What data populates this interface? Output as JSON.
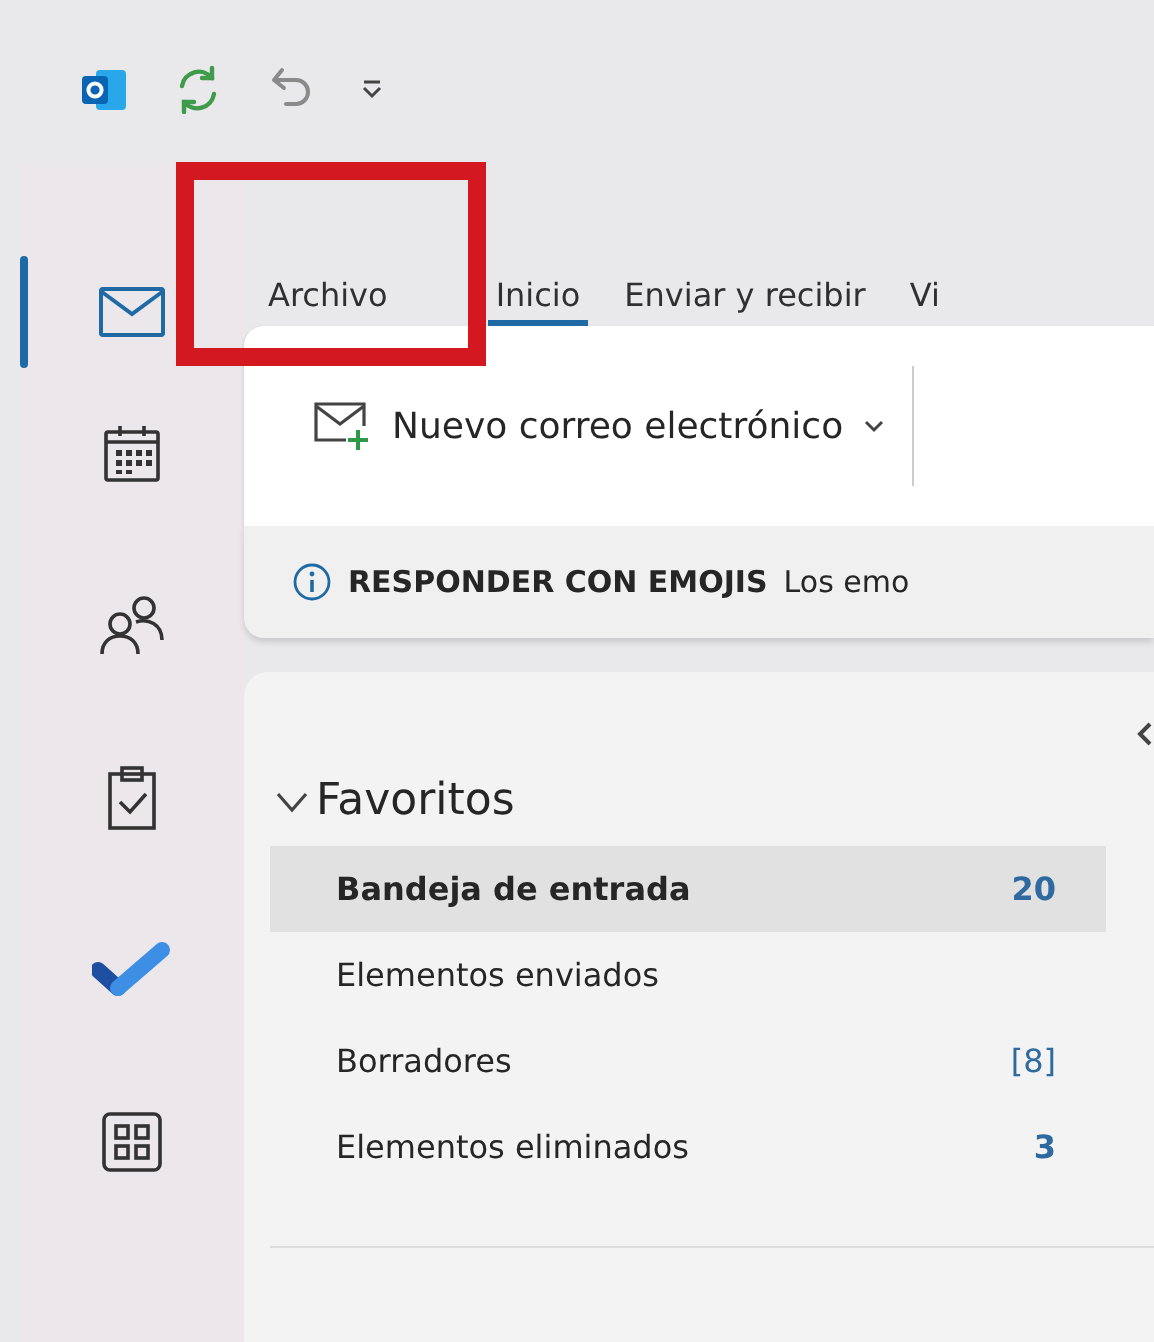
{
  "quick_access": [
    {
      "kind": "outlook"
    },
    {
      "kind": "sync"
    },
    {
      "kind": "undo"
    },
    {
      "kind": "customize"
    }
  ],
  "nav_rail": [
    {
      "kind": "mail",
      "selected": true
    },
    {
      "kind": "calendar",
      "selected": false
    },
    {
      "kind": "people",
      "selected": false
    },
    {
      "kind": "tasks",
      "selected": false
    },
    {
      "kind": "todo",
      "selected": false
    },
    {
      "kind": "apps",
      "selected": false
    }
  ],
  "tabs": [
    {
      "label": "Archivo",
      "selected": false,
      "highlighted": true
    },
    {
      "label": "Inicio",
      "selected": true,
      "highlighted": false
    },
    {
      "label": "Enviar y recibir",
      "selected": false,
      "highlighted": false
    },
    {
      "label": "Vi",
      "selected": false,
      "highlighted": false
    }
  ],
  "ribbon": {
    "new_mail_button": "Nuevo correo electrónico"
  },
  "info_bar": {
    "title": "RESPONDER CON EMOJIS",
    "message": "Los emo"
  },
  "folder_pane": {
    "section": {
      "label": "Favoritos",
      "expanded": true
    },
    "folders": [
      {
        "name": "Bandeja de entrada",
        "count": "20",
        "count_bold": true,
        "selected": true
      },
      {
        "name": "Elementos enviados",
        "selected": false
      },
      {
        "name": "Borradores",
        "count": "[8]",
        "count_bold": false,
        "selected": false
      },
      {
        "name": "Elementos eliminados",
        "count": "3",
        "count_bold": true,
        "selected": false
      }
    ]
  }
}
